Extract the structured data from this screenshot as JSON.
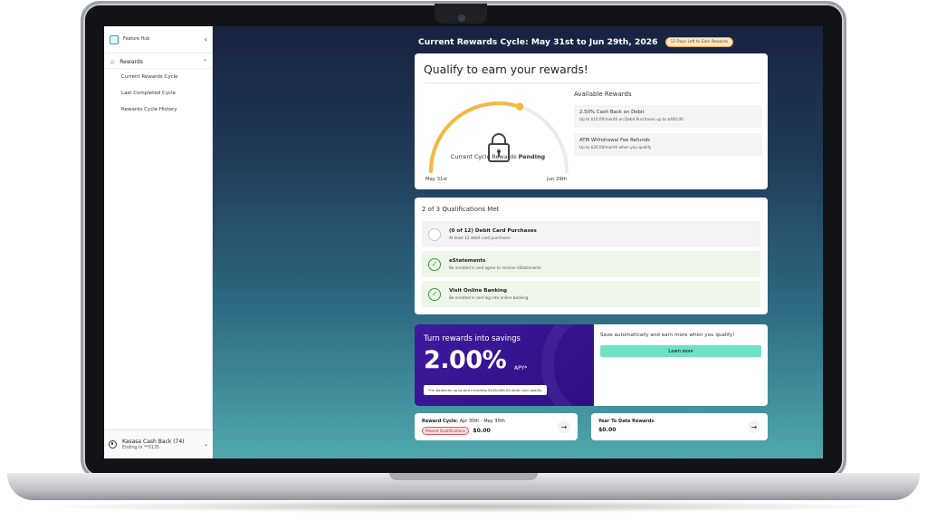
{
  "sidebar": {
    "title": "Feature Hub",
    "collapse_icon": "‹",
    "section": {
      "label": "Rewards",
      "icon": "star-icon",
      "items": [
        {
          "label": "Current Rewards Cycle"
        },
        {
          "label": "Last Completed Cycle"
        },
        {
          "label": "Rewards Cycle History"
        }
      ]
    },
    "account": {
      "name": "Kasasa Cash Back (74)",
      "sub": "Ending in **0135"
    }
  },
  "header": {
    "title": "Current Rewards Cycle: May 31st to Jun 29th, 2026",
    "badge": "12 Days Left to Earn Rewards"
  },
  "qualify": {
    "title": "Qualify to earn your rewards!",
    "gauge": {
      "status_prefix": "Current Cycle Rewards ",
      "status_value": "Pending",
      "start_label": "May 31st",
      "end_label": "Jun 29th",
      "progress": 0.6
    },
    "available_title": "Available Rewards",
    "rewards": [
      {
        "name": "2.50% Cash Back on Debit",
        "desc": "Up to $10.00/month on Debit Purchases up to $400.00"
      },
      {
        "name": "ATM Withdrawal Fee Refunds",
        "desc": "Up to $20.00/month when you qualify"
      }
    ]
  },
  "qualifications": {
    "title": "2 of 3 Qualifications Met",
    "items": [
      {
        "name": "(0 of 12) Debit Card Purchases",
        "desc": "At least 12 debit card purchases",
        "status": "pending"
      },
      {
        "name": "eStatements",
        "desc": "Be enrolled in and agree to receive eStatements",
        "status": "met"
      },
      {
        "name": "Visit Online Banking",
        "desc": "Be enrolled in and log into online banking",
        "status": "met"
      }
    ]
  },
  "savings": {
    "heading": "Turn rewards into savings",
    "apy": "2.00%",
    "apy_suffix": "APY*",
    "note": "*On balances up to and including $100,000.00 when you qualify.",
    "right_text": "Save automatically and earn more when you qualify!",
    "button_label": "Learn more"
  },
  "summary": {
    "cycle": {
      "label": "Reward Cycle:",
      "range": "Apr 30th - May 30th",
      "badge": "Missed Qualifications",
      "value": "$0.00"
    },
    "ytd": {
      "label": "Year To Date Rewards",
      "value": "$0.00"
    }
  },
  "colors": {
    "accent": "#f4b740",
    "success": "#3e9a3e",
    "savings_purple": "#3e1a9e",
    "learn_button": "#6ee2c4"
  }
}
